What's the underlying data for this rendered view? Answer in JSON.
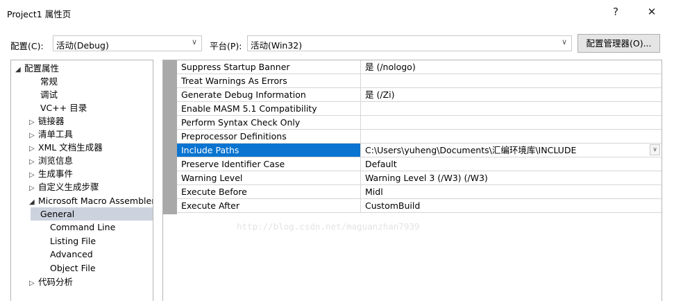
{
  "window": {
    "title": "Project1 属性页",
    "help_glyph": "?",
    "close_glyph": "✕"
  },
  "config_bar": {
    "config_label": "配置(C):",
    "config_value": "活动(Debug)",
    "platform_label": "平台(P):",
    "platform_value": "活动(Win32)",
    "manager_button": "配置管理器(O)...",
    "dropdown_glyph": "∨"
  },
  "tree": {
    "items": [
      {
        "label": "配置属性",
        "toggle": "◢"
      },
      {
        "label": "常规",
        "toggle": ""
      },
      {
        "label": "调试",
        "toggle": ""
      },
      {
        "label": "VC++ 目录",
        "toggle": ""
      },
      {
        "label": "链接器",
        "toggle": "▷"
      },
      {
        "label": "清单工具",
        "toggle": "▷"
      },
      {
        "label": "XML 文档生成器",
        "toggle": "▷"
      },
      {
        "label": "浏览信息",
        "toggle": "▷"
      },
      {
        "label": "生成事件",
        "toggle": "▷"
      },
      {
        "label": "自定义生成步骤",
        "toggle": "▷"
      },
      {
        "label": "Microsoft Macro Assembler",
        "toggle": "◢"
      },
      {
        "label": "General",
        "toggle": ""
      },
      {
        "label": "Command Line",
        "toggle": ""
      },
      {
        "label": "Listing File",
        "toggle": ""
      },
      {
        "label": "Advanced",
        "toggle": ""
      },
      {
        "label": "Object File",
        "toggle": ""
      },
      {
        "label": "代码分析",
        "toggle": "▷"
      }
    ]
  },
  "properties": {
    "rows": [
      {
        "name": "Suppress Startup Banner",
        "value": "是 (/nologo)"
      },
      {
        "name": "Treat Warnings As Errors",
        "value": ""
      },
      {
        "name": "Generate Debug Information",
        "value": "是 (/Zi)"
      },
      {
        "name": "Enable MASM 5.1 Compatibility",
        "value": ""
      },
      {
        "name": "Perform Syntax Check Only",
        "value": ""
      },
      {
        "name": "Preprocessor Definitions",
        "value": ""
      },
      {
        "name": "Include Paths",
        "value": "C:\\Users\\yuheng\\Documents\\汇编环境库\\INCLUDE"
      },
      {
        "name": "Preserve Identifier Case",
        "value": "Default"
      },
      {
        "name": "Warning Level",
        "value": "Warning Level 3 (/W3) (/W3)"
      },
      {
        "name": "Execute Before",
        "value": "Midl"
      },
      {
        "name": "Execute After",
        "value": "CustomBuild"
      }
    ],
    "selected_index": 6
  },
  "watermark": "http://blog.csdn.net/maguanzhan7939"
}
